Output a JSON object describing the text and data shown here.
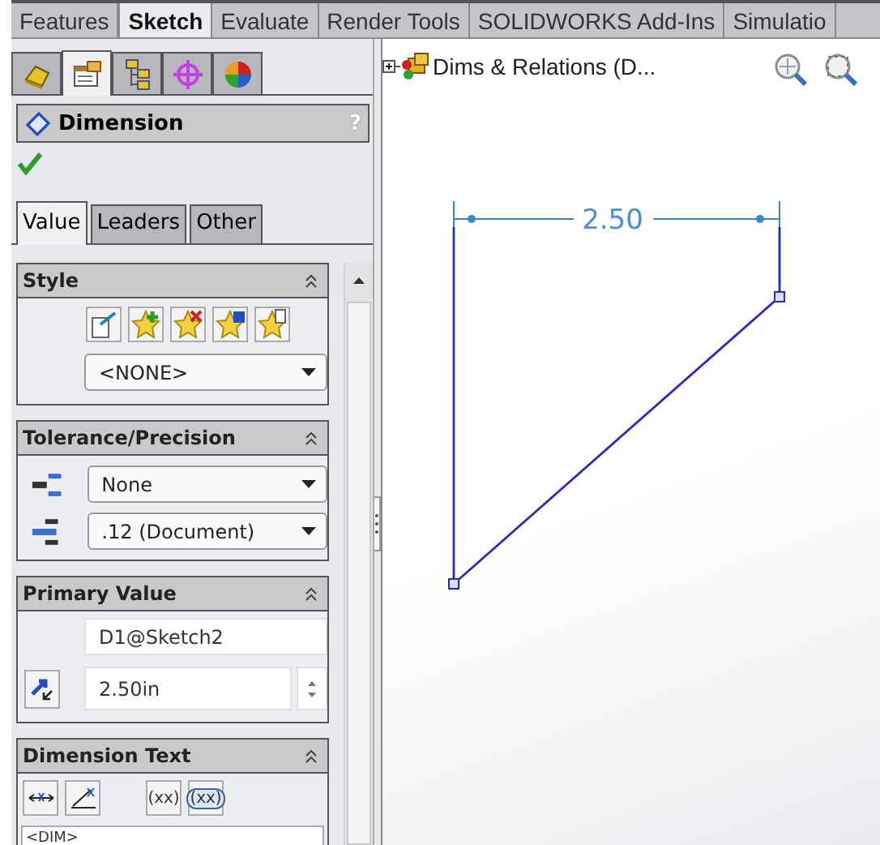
{
  "ribbon_tabs": [
    {
      "label": "Features",
      "selected": false
    },
    {
      "label": "Sketch",
      "selected": true
    },
    {
      "label": "Evaluate",
      "selected": false
    },
    {
      "label": "Render Tools",
      "selected": false
    },
    {
      "label": "SOLIDWORKS Add-Ins",
      "selected": false
    },
    {
      "label": "Simulatio",
      "selected": false
    }
  ],
  "panel": {
    "icon_tabs": [
      {
        "kind": "feature",
        "selected": false
      },
      {
        "kind": "property",
        "selected": true
      },
      {
        "kind": "config",
        "selected": false
      },
      {
        "kind": "target",
        "selected": false
      },
      {
        "kind": "appearance",
        "selected": false
      }
    ],
    "title": "Dimension",
    "help": "?",
    "value_tabs": [
      {
        "label": "Value",
        "selected": true
      },
      {
        "label": "Leaders",
        "selected": false
      },
      {
        "label": "Other",
        "selected": false
      }
    ],
    "style": {
      "title": "Style",
      "dropdown": "<NONE>"
    },
    "tolerance": {
      "title": "Tolerance/Precision",
      "tolerance_type": "None",
      "precision": ".12 (Document)"
    },
    "primary_value": {
      "title": "Primary Value",
      "name": "D1@Sketch2",
      "value": "2.50in"
    },
    "dimension_text": {
      "title": "Dimension Text",
      "buttons": [
        {
          "kind": "arrows"
        },
        {
          "kind": "angle"
        },
        {
          "kind": "text",
          "label": "(xx)"
        },
        {
          "kind": "boxed",
          "label": "(xx)"
        }
      ],
      "text": "<DIM>"
    }
  },
  "canvas": {
    "tree_label": "Dims & Relations  (D...",
    "dimension": "2.50"
  }
}
